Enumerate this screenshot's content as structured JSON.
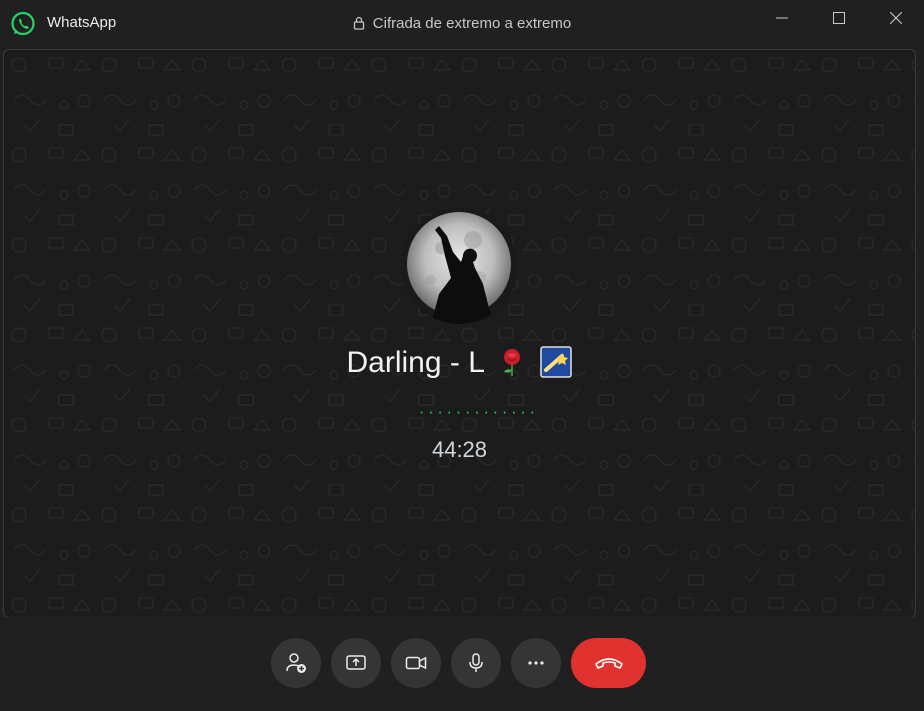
{
  "window": {
    "app_name": "WhatsApp",
    "encryption_text": "Cifrada de extremo a extremo",
    "icons": [
      "whatsapp-logo",
      "lock-icon",
      "minimize-icon",
      "maximize-icon",
      "close-icon"
    ]
  },
  "call": {
    "contact_name": "Darling - L",
    "name_emojis": [
      "rose",
      "shooting-star"
    ],
    "status_indicator": "·············",
    "duration": "44:28"
  },
  "controls": {
    "buttons": [
      "add-participant",
      "share-screen",
      "video",
      "microphone",
      "more",
      "end-call"
    ]
  },
  "colors": {
    "background": "#202020",
    "accent": "#25d366",
    "end_call": "#e0322f",
    "button_bg": "#353535"
  }
}
